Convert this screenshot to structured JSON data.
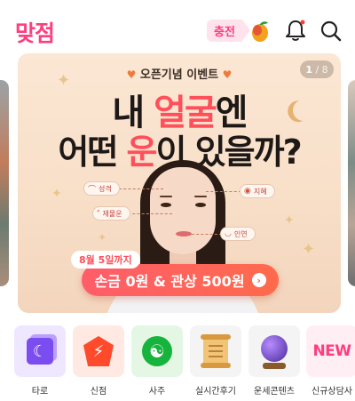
{
  "header": {
    "logo": "맞점",
    "charge_label": "충전"
  },
  "banner": {
    "counter_current": "1",
    "counter_total": "/ 8",
    "event_tag": "오픈기념 이벤트",
    "headline_line1_a": "내 ",
    "headline_line1_accent": "얼굴",
    "headline_line1_b": "엔",
    "headline_line2_a": "어떤 ",
    "headline_line2_accent": "운",
    "headline_line2_b": "이 있을까?",
    "chips": {
      "left_top": "성격",
      "left_bottom": "재물운",
      "right_top": "지혜",
      "right_bottom": "인연"
    },
    "deadline": "8월 5일까지",
    "cta": "손금 0원 & 관상 500원"
  },
  "categories": [
    {
      "label": "타로",
      "icon": "tarot-moon-icon",
      "bg": "#efe7ff"
    },
    {
      "label": "신점",
      "icon": "bolt-shield-icon",
      "bg": "#ffe9e2"
    },
    {
      "label": "사주",
      "icon": "yin-yang-icon",
      "bg": "#e4f7e4"
    },
    {
      "label": "실시간후기",
      "icon": "scroll-icon",
      "bg": "#f4f4f4"
    },
    {
      "label": "운세콘텐츠",
      "icon": "crystal-ball-icon",
      "bg": "#f4f4f4"
    },
    {
      "label": "신규상담사",
      "icon": "new-badge-icon",
      "bg": "#ffeef3",
      "badge": "NEW"
    }
  ],
  "colors": {
    "brand": "#ff3d7f",
    "accent": "#ff4f5a"
  }
}
